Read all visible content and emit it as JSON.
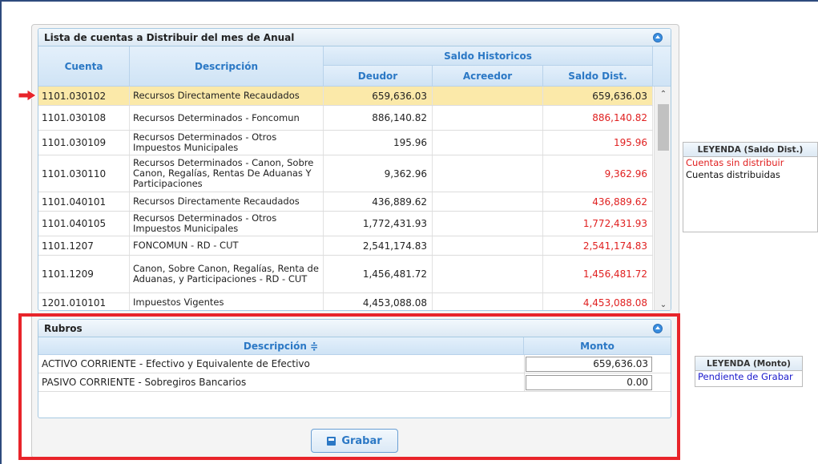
{
  "panel1": {
    "title": "Lista de cuentas a Distribuir del mes de Anual",
    "headers": {
      "cuenta": "Cuenta",
      "descripcion": "Descripción",
      "saldo_group": "Saldo Historicos",
      "deudor": "Deudor",
      "acreedor": "Acreedor",
      "saldo_dist": "Saldo Dist."
    },
    "rows": [
      {
        "cuenta": "1101.030102",
        "descripcion": "Recursos Directamente Recaudados",
        "deudor": "659,636.03",
        "acreedor": "",
        "saldo": "659,636.03",
        "selected": true
      },
      {
        "cuenta": "1101.030108",
        "descripcion": "Recursos Determinados - Foncomun",
        "deudor": "886,140.82",
        "acreedor": "",
        "saldo": "886,140.82"
      },
      {
        "cuenta": "1101.030109",
        "descripcion": "Recursos Determinados - Otros Impuestos Municipales",
        "deudor": "195.96",
        "acreedor": "",
        "saldo": "195.96"
      },
      {
        "cuenta": "1101.030110",
        "descripcion": "Recursos Determinados - Canon, Sobre Canon, Regalías, Rentas De Aduanas Y Participaciones",
        "deudor": "9,362.96",
        "acreedor": "",
        "saldo": "9,362.96"
      },
      {
        "cuenta": "1101.040101",
        "descripcion": "Recursos Directamente Recaudados",
        "deudor": "436,889.62",
        "acreedor": "",
        "saldo": "436,889.62"
      },
      {
        "cuenta": "1101.040105",
        "descripcion": "Recursos Determinados - Otros Impuestos Municipales",
        "deudor": "1,772,431.93",
        "acreedor": "",
        "saldo": "1,772,431.93"
      },
      {
        "cuenta": "1101.1207",
        "descripcion": "FONCOMUN - RD - CUT",
        "deudor": "2,541,174.83",
        "acreedor": "",
        "saldo": "2,541,174.83"
      },
      {
        "cuenta": "1101.1209",
        "descripcion": "Canon, Sobre Canon, Regalías, Renta de Aduanas, y Participaciones - RD - CUT",
        "deudor": "1,456,481.72",
        "acreedor": "",
        "saldo": "1,456,481.72"
      },
      {
        "cuenta": "1201.010101",
        "descripcion": "Impuestos Vigentes",
        "deudor": "4,453,088.08",
        "acreedor": "",
        "saldo": "4,453,088.08"
      }
    ]
  },
  "panel2": {
    "title": "Rubros",
    "headers": {
      "descripcion": "Descripción ≑",
      "monto": "Monto"
    },
    "rows": [
      {
        "descripcion": "ACTIVO CORRIENTE - Efectivo y Equivalente de Efectivo",
        "monto": "659,636.03"
      },
      {
        "descripcion": "PASIVO CORRIENTE - Sobregiros Bancarios",
        "monto": "0.00"
      }
    ]
  },
  "grabar_label": "Grabar",
  "legend_saldo": {
    "title": "LEYENDA (Saldo Dist.)",
    "items": [
      {
        "label": "Cuentas sin distribuir",
        "color": "#e02020"
      },
      {
        "label": "Cuentas distribuidas",
        "color": "#111111"
      }
    ]
  },
  "legend_monto": {
    "title": "LEYENDA (Monto)",
    "items": [
      {
        "label": "Pendiente de Grabar",
        "color": "#1a1acc"
      }
    ]
  },
  "colors": {
    "accent": "#2b78c5",
    "highlight_row": "#fbe9a9",
    "pending_red": "#e02020",
    "annotation_red": "#e8242a"
  }
}
